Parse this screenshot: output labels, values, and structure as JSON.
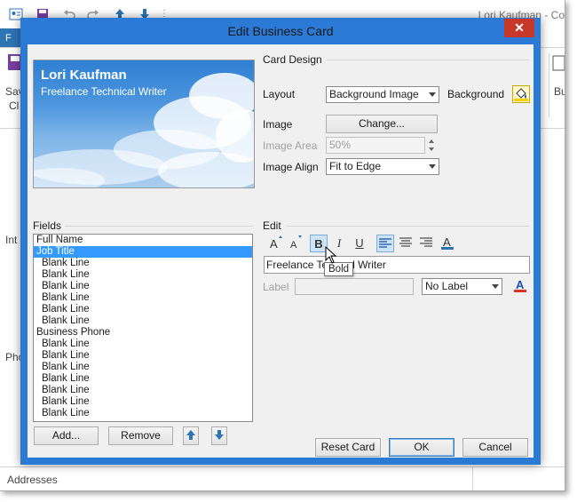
{
  "background_window": {
    "title": "Lori Kaufman - Co",
    "ribbon_tab_label": "F",
    "left_labels": [
      "Sav",
      "Cl",
      "Int",
      "Pho"
    ],
    "right_label": "Bu",
    "footer_label": "Addresses"
  },
  "dialog": {
    "title": "Edit Business Card",
    "close_glyph": "✕"
  },
  "card_preview": {
    "name": "Lori Kaufman",
    "job_title": "Freelance Technical Writer"
  },
  "card_design": {
    "section_label": "Card Design",
    "layout_label": "Layout",
    "layout_value": "Background Image",
    "background_label": "Background",
    "image_label": "Image",
    "change_button": "Change...",
    "image_area_label": "Image Area",
    "image_area_value": "50%",
    "image_align_label": "Image Align",
    "image_align_value": "Fit to Edge"
  },
  "fields": {
    "section_label": "Fields",
    "items": [
      {
        "label": "Full Name",
        "indent": false,
        "selected": false
      },
      {
        "label": "Job Title",
        "indent": false,
        "selected": true
      },
      {
        "label": "Blank Line",
        "indent": true,
        "selected": false
      },
      {
        "label": "Blank Line",
        "indent": true,
        "selected": false
      },
      {
        "label": "Blank Line",
        "indent": true,
        "selected": false
      },
      {
        "label": "Blank Line",
        "indent": true,
        "selected": false
      },
      {
        "label": "Blank Line",
        "indent": true,
        "selected": false
      },
      {
        "label": "Blank Line",
        "indent": true,
        "selected": false
      },
      {
        "label": "Business Phone",
        "indent": false,
        "selected": false
      },
      {
        "label": "Blank Line",
        "indent": true,
        "selected": false
      },
      {
        "label": "Blank Line",
        "indent": true,
        "selected": false
      },
      {
        "label": "Blank Line",
        "indent": true,
        "selected": false
      },
      {
        "label": "Blank Line",
        "indent": true,
        "selected": false
      },
      {
        "label": "Blank Line",
        "indent": true,
        "selected": false
      },
      {
        "label": "Blank Line",
        "indent": true,
        "selected": false
      },
      {
        "label": "Blank Line",
        "indent": true,
        "selected": false
      }
    ],
    "add_button": "Add...",
    "remove_button": "Remove"
  },
  "edit": {
    "section_label": "Edit",
    "bold_glyph": "B",
    "italic_glyph": "I",
    "underline_glyph": "U",
    "text_value": "Freelance Tec",
    "text_value_tail": "l Writer",
    "tooltip": "Bold",
    "label_label": "Label",
    "label_position_value": "No Label"
  },
  "buttons": {
    "reset": "Reset Card",
    "ok": "OK",
    "cancel": "Cancel"
  },
  "colors": {
    "dialog_frame": "#2a7ad6",
    "selection": "#3399ff",
    "close_button": "#c7382a"
  }
}
